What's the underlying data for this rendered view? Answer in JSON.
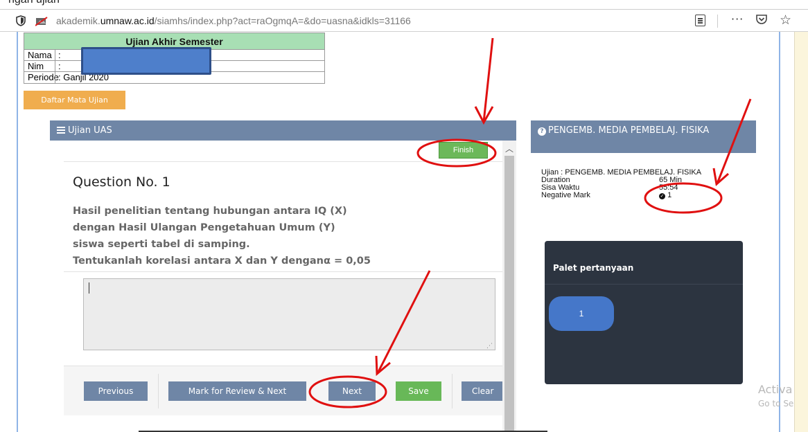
{
  "top_caption": "ngan ujian",
  "browser": {
    "url_prefix": "akademik.",
    "url_domain": "umnaw.ac.id",
    "url_path": "/siamhs/index.php?act=raOgmqA=&do=uasna&idkls=31166"
  },
  "header_table": {
    "title": "Ujian Akhir Semester",
    "rows": [
      {
        "key": "Nama",
        "value": ":"
      },
      {
        "key": "Nim",
        "value": ":"
      },
      {
        "key": "Periode",
        "value": ": Ganjil 2020"
      }
    ]
  },
  "daftar_button": "Daftar Mata Ujian",
  "exam_panel": {
    "title": "Ujian UAS",
    "finish_label": "Finish",
    "question_title": "Question No. 1",
    "question_lines": [
      "Hasil penelitian tentang hubungan antara IQ (X)",
      "dengan Hasil Ulangan Pengetahuan Umum (Y)",
      "siswa seperti tabel di samping.",
      "Tentukanlah korelasi antara X dan Y denganα = 0,05"
    ],
    "answer_value": ""
  },
  "footer_buttons": {
    "previous": "Previous",
    "mark_review": "Mark for Review & Next",
    "next": "Next",
    "save": "Save",
    "clear": "Clear"
  },
  "side_panel": {
    "title": "PENGEMB. MEDIA PEMBELAJ. FISIKA",
    "ujian_label": "Ujian : PENGEMB. MEDIA PEMBELAJ. FISIKA",
    "duration_label": "Duration",
    "duration_value": "65 Min",
    "sisa_label": "Sisa Waktu",
    "sisa_value": "55:54",
    "negative_label": "Negative Mark",
    "negative_value": "1"
  },
  "palette": {
    "title": "Palet pertanyaan",
    "items": [
      "1"
    ]
  },
  "watermark": {
    "line1": "Activa",
    "line2": "Go to Se"
  },
  "colors": {
    "panel_header": "#6f86a6",
    "finish_green": "#6cb85a",
    "orange_button": "#f0ad4e",
    "palette_bg": "#2c3440",
    "palette_item": "#4577c9",
    "annotation_red": "#e01010"
  }
}
